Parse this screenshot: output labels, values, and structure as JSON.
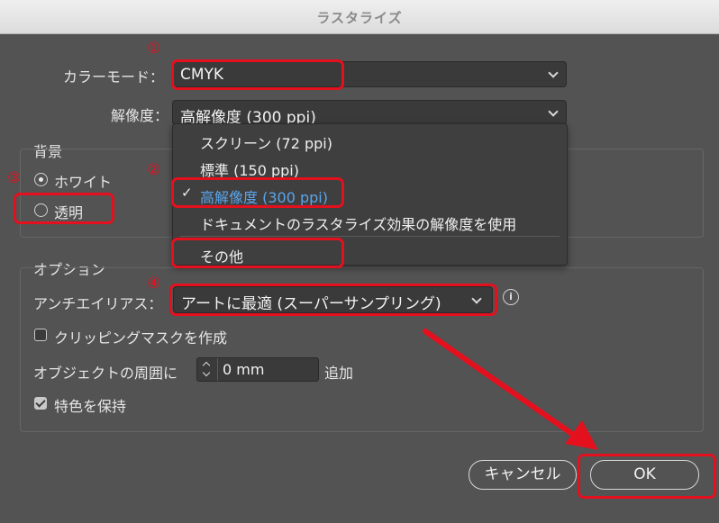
{
  "window": {
    "title": "ラスタライズ"
  },
  "color_mode": {
    "label": "カラーモード：",
    "value": "CMYK"
  },
  "resolution": {
    "label": "解像度：",
    "value": "高解像度 (300 ppi)",
    "options": [
      "スクリーン (72 ppi)",
      "標準 (150 ppi)",
      "高解像度 (300 ppi)",
      "ドキュメントのラスタライズ効果の解像度を使用",
      "その他"
    ],
    "checkmark": "✓"
  },
  "background": {
    "heading": "背景",
    "white_label": "ホワイト",
    "transparent_label": "透明"
  },
  "options": {
    "heading": "オプション",
    "antialias_label": "アンチエイリアス：",
    "antialias_value": "アートに最適 (スーパーサンプリング)",
    "clipping_label": "クリッピングマスクを作成",
    "around_label": "オブジェクトの周囲に",
    "around_value": "0 mm",
    "add_label": "追加",
    "spot_label": "特色を保持",
    "info_glyph": "i"
  },
  "buttons": {
    "cancel": "キャンセル",
    "ok": "OK"
  },
  "annotations": {
    "n1": "①",
    "n2": "②",
    "n3": "③",
    "n4": "④"
  },
  "colors": {
    "annotation_red": "#e4101e",
    "selected_blue": "#5aa5ec"
  },
  "icons": [
    "chevron-down-icon",
    "checkmark-icon",
    "info-icon",
    "stepper-icon",
    "red-arrow"
  ]
}
